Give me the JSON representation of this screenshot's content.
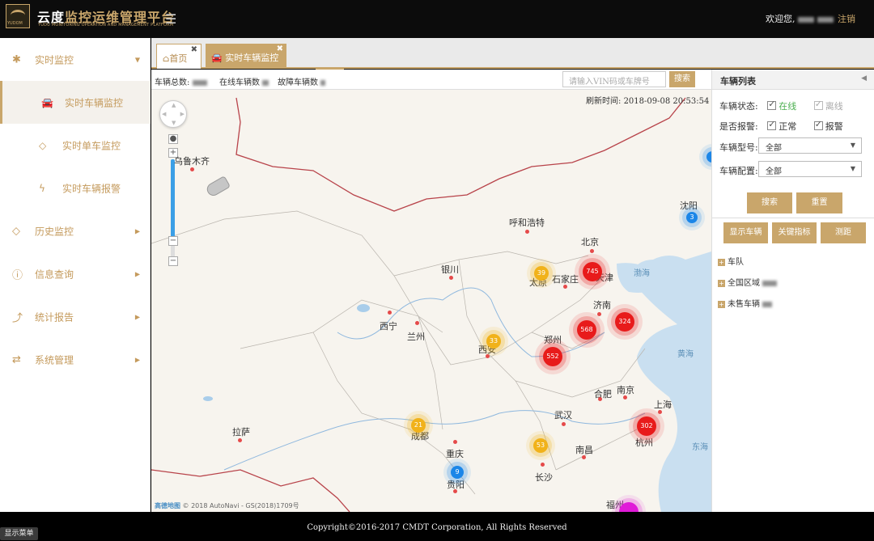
{
  "header": {
    "brand_white": "云度",
    "brand_gold": "监控运维管理平台",
    "brand_sub": "YUDU MONITORING OPERATION AND MANAGEMENT PLATFORM",
    "logo_text": "YUDOM",
    "menu_icon": "hamburger-icon",
    "welcome": "欢迎您,",
    "logout": "注销"
  },
  "sidebar": {
    "items": [
      {
        "icon": "asterisk-icon",
        "label": "实时监控",
        "expanded": true
      },
      {
        "icon": "car-icon",
        "label": "实时车辆监控",
        "active": true
      },
      {
        "icon": "eye-icon",
        "label": "实时单车监控"
      },
      {
        "icon": "bolt-icon",
        "label": "实时车辆报警"
      },
      {
        "icon": "eye-icon",
        "label": "历史监控"
      },
      {
        "icon": "info-icon",
        "label": "信息查询"
      },
      {
        "icon": "chart-icon",
        "label": "统计报告"
      },
      {
        "icon": "exchange-icon",
        "label": "系统管理"
      }
    ]
  },
  "tabs": [
    {
      "label": "首页",
      "icon": "home-icon"
    },
    {
      "label": "实时车辆监控",
      "icon": "car-icon",
      "active": true
    }
  ],
  "toolbar": {
    "total_label": "车辆总数:",
    "online_label": "在线车辆数",
    "fault_label": "故障车辆数",
    "search_placeholder": "请输入VIN码或车牌号",
    "search_button": "搜索"
  },
  "map": {
    "refresh_label": "刷新时间:",
    "refresh_time": "2018-09-08 20:53:54",
    "attribution_logo": "高德地图",
    "attribution_text": "© 2018 AutoNavi - GS(2018)1709号",
    "cities": [
      "乌鲁木齐",
      "呼和浩特",
      "北京",
      "银川",
      "太原",
      "石家庄",
      "天津",
      "沈阳",
      "济南",
      "西宁",
      "兰州",
      "郑州",
      "西安",
      "合肥",
      "南京",
      "上海",
      "拉萨",
      "成都",
      "武汉",
      "杭州",
      "重庆",
      "南昌",
      "长沙",
      "贵阳",
      "福州"
    ],
    "seas": [
      "渤海",
      "黄海",
      "东海"
    ],
    "clusters": [
      {
        "value": "3",
        "color": "blue"
      },
      {
        "value": "39",
        "color": "yellow"
      },
      {
        "value": "745",
        "color": "red"
      },
      {
        "value": "568",
        "color": "red"
      },
      {
        "value": "324",
        "color": "red"
      },
      {
        "value": "33",
        "color": "yellow"
      },
      {
        "value": "552",
        "color": "red"
      },
      {
        "value": "21",
        "color": "yellow"
      },
      {
        "value": "53",
        "color": "yellow"
      },
      {
        "value": "302",
        "color": "red"
      },
      {
        "value": "9",
        "color": "blue"
      },
      {
        "value": "",
        "color": "pink"
      },
      {
        "value": "",
        "color": "blue"
      }
    ]
  },
  "panel": {
    "title": "车辆列表",
    "status_label": "车辆状态:",
    "online": "在线",
    "offline": "离线",
    "alarm_label": "是否报警:",
    "normal": "正常",
    "alarm": "报警",
    "model_label": "车辆型号:",
    "model_value": "全部",
    "config_label": "车辆配置:",
    "config_value": "全部",
    "search_button": "搜索",
    "reset_button": "重置",
    "show_vehicles": "显示车辆",
    "key_metrics": "关键指标",
    "measure": "测距",
    "tree": [
      "车队",
      "全国区域",
      "未售车辆"
    ],
    "colors": {
      "online": "#4caf50",
      "accent": "#c9a66b"
    }
  },
  "footer": {
    "copyright": "Copyright©2016-2017 CMDT Corporation, All Rights Reserved",
    "show_menu": "显示菜单"
  }
}
